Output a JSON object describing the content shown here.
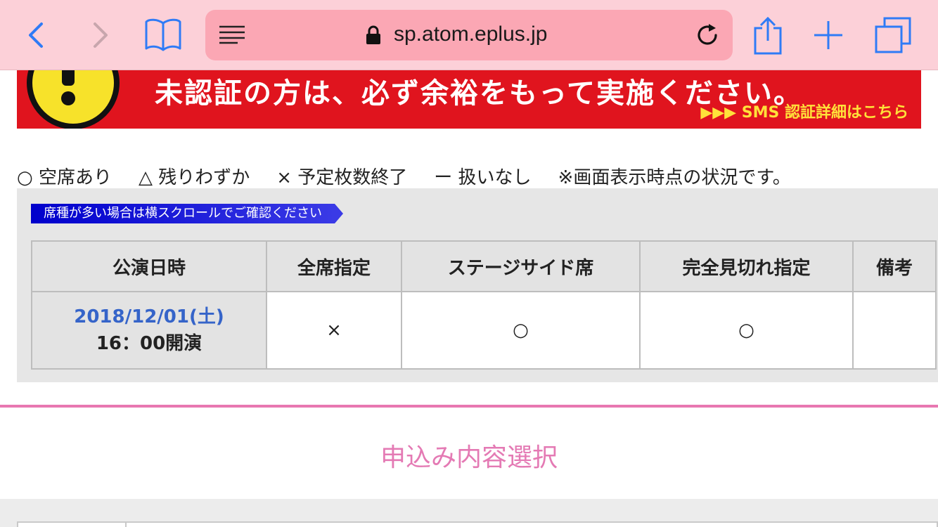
{
  "browser": {
    "url": "sp.atom.eplus.jp",
    "icons": [
      "back-icon",
      "forward-icon",
      "bookmarks-icon",
      "reader-icon",
      "lock-icon",
      "reload-icon",
      "share-icon",
      "new-tab-icon",
      "tabs-icon"
    ]
  },
  "banner": {
    "headline": "未認証の方は、必ず余裕をもって実施ください。",
    "link": "▶▶▶ SMS 認証詳細はこちら"
  },
  "legend": {
    "available": "○ 空席あり",
    "few_left": "△ 残りわずか",
    "sold_out": "× 予定枚数終了",
    "not_handled": "ー 扱いなし",
    "note": "※画面表示時点の状況です。"
  },
  "table": {
    "scroll_hint": "席種が多い場合は横スクロールでご確認ください",
    "headers": [
      "公演日時",
      "全席指定",
      "ステージサイド席",
      "完全見切れ指定",
      "備考"
    ],
    "rows": [
      {
        "date": "2018/12/01(土)",
        "time": "16：00開演",
        "cells": [
          "×",
          "○",
          "○",
          ""
        ]
      }
    ]
  },
  "section": {
    "title": "申込み内容選択"
  },
  "colors": {
    "toolbar": "#fcd0d8",
    "urlbar": "#fba7b4",
    "banner": "#e0141e",
    "accent_pink": "#e878b1",
    "link_blue": "#3564c9"
  }
}
